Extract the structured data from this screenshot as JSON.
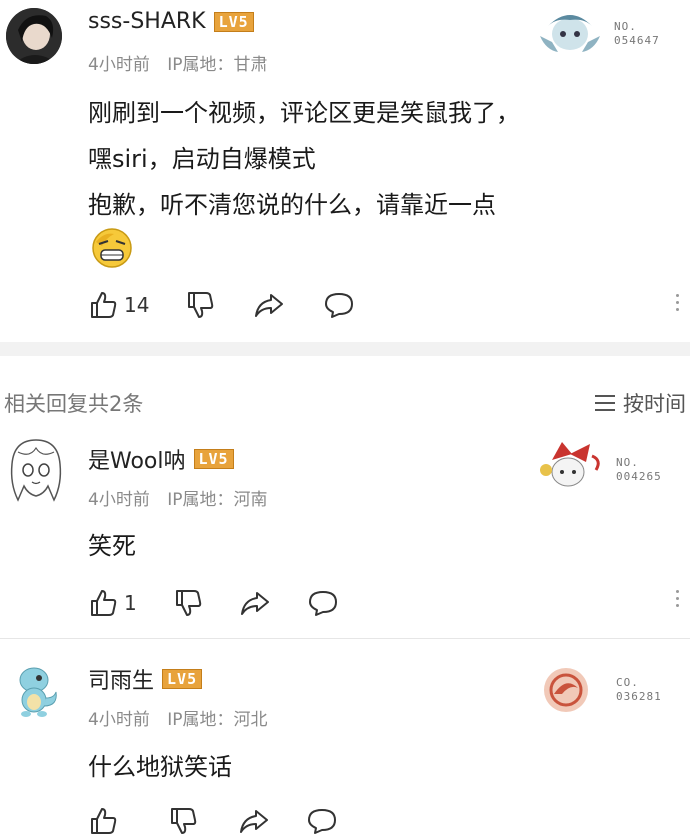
{
  "main_comment": {
    "username": "sss-SHARK",
    "level": "LV5",
    "time": "4小时前",
    "ip": "IP属地：甘肃",
    "badge_no_label": "NO.",
    "badge_no_value": "054647",
    "lines": [
      "刚刷到一个视频，评论区更是笑鼠我了，",
      "嘿siri，启动自爆模式",
      "抱歉，听不清您说的什么，请靠近一点"
    ],
    "emoji": "grimace-face-emoji",
    "likes": "14"
  },
  "replies_header": {
    "label": "相关回复共2条",
    "sort_label": "按时间"
  },
  "replies": [
    {
      "username": "是Wool呐",
      "level": "LV5",
      "time": "4小时前",
      "ip": "IP属地：河南",
      "badge_no_label": "NO.",
      "badge_no_value": "004265",
      "text": "笑死",
      "likes": "1"
    },
    {
      "username": "司雨生",
      "level": "LV5",
      "time": "4小时前",
      "ip": "IP属地：河北",
      "badge_no_label": "CO.",
      "badge_no_value": "036281",
      "text": "什么地狱笑话",
      "likes": ""
    }
  ],
  "colors": {
    "level_badge": "#e8a33c",
    "meta_text": "#8a8a8a",
    "divider": "#f2f2f2"
  }
}
